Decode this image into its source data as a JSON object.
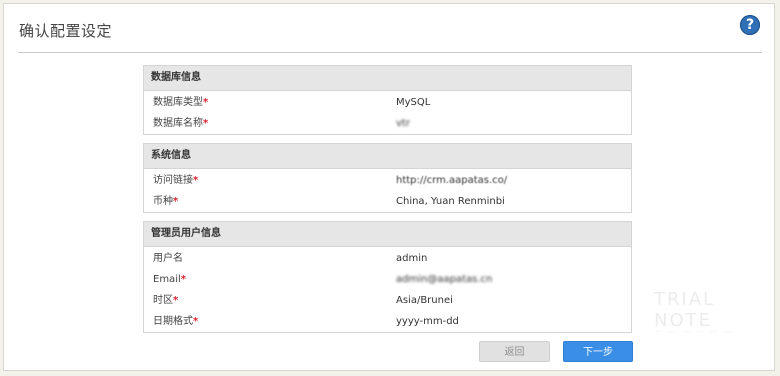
{
  "page": {
    "title": "确认配置设定",
    "help_icon": "?"
  },
  "watermark": {
    "line1": "TRIAL NOTE",
    "line2": "— — — — — —"
  },
  "database": {
    "heading": "数据库信息",
    "rows": [
      {
        "label": "数据库类型",
        "value": "MySQL"
      },
      {
        "label": "数据库名称",
        "value": "vtr"
      }
    ]
  },
  "system": {
    "heading": "系统信息",
    "rows": [
      {
        "label": "访问链接",
        "value": "http://crm.aapatas.co/"
      },
      {
        "label": "币种",
        "value": "China, Yuan Renminbi"
      }
    ]
  },
  "admin": {
    "heading": "管理员用户信息",
    "rows": [
      {
        "label": "用户名",
        "value": "admin"
      },
      {
        "label": "Email",
        "value": "admin@aapatas.cn"
      },
      {
        "label": "时区",
        "value": "Asia/Brunei"
      },
      {
        "label": "日期格式",
        "value": "yyyy-mm-dd"
      }
    ]
  },
  "buttons": {
    "back": "返回",
    "next": "下一步"
  },
  "required_mark": "*"
}
